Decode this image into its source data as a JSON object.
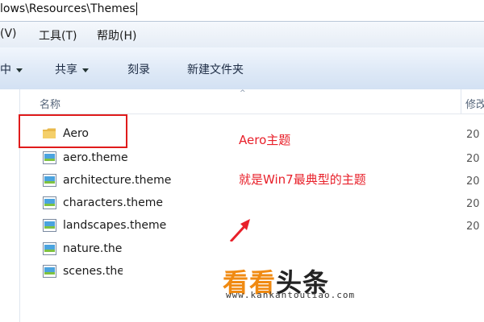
{
  "address": {
    "path": "lows\\Resources\\Themes"
  },
  "menu": {
    "items": [
      "(V)",
      "工具(T)",
      "帮助(H)"
    ]
  },
  "toolbar": {
    "organize_fragment": "中",
    "share": "共享",
    "burn": "刻录",
    "new_folder": "新建文件夹"
  },
  "columns": {
    "name": "名称",
    "modified": "修改"
  },
  "files": [
    {
      "name": "Aero",
      "type": "folder",
      "date": "20"
    },
    {
      "name": "aero.theme",
      "type": "theme",
      "date": "20"
    },
    {
      "name": "architecture.theme",
      "type": "theme",
      "date": "20"
    },
    {
      "name": "characters.theme",
      "type": "theme",
      "date": "20"
    },
    {
      "name": "landscapes.theme",
      "type": "theme",
      "date": "20"
    },
    {
      "name": "nature.the",
      "type": "theme",
      "date": "20"
    },
    {
      "name": "scenes.the",
      "type": "theme",
      "date": "20"
    }
  ],
  "annotations": {
    "line1": "Aero主题",
    "line2": "就是Win7最典型的主题"
  },
  "watermark": {
    "logo_part1": "看看",
    "logo_part2": "头条",
    "url": "www.kankantoutiao.com"
  },
  "colors": {
    "highlight": "#e01b1b",
    "annotation": "#e8202a",
    "folder": "#e8b84a",
    "accent": "#f08a12"
  }
}
